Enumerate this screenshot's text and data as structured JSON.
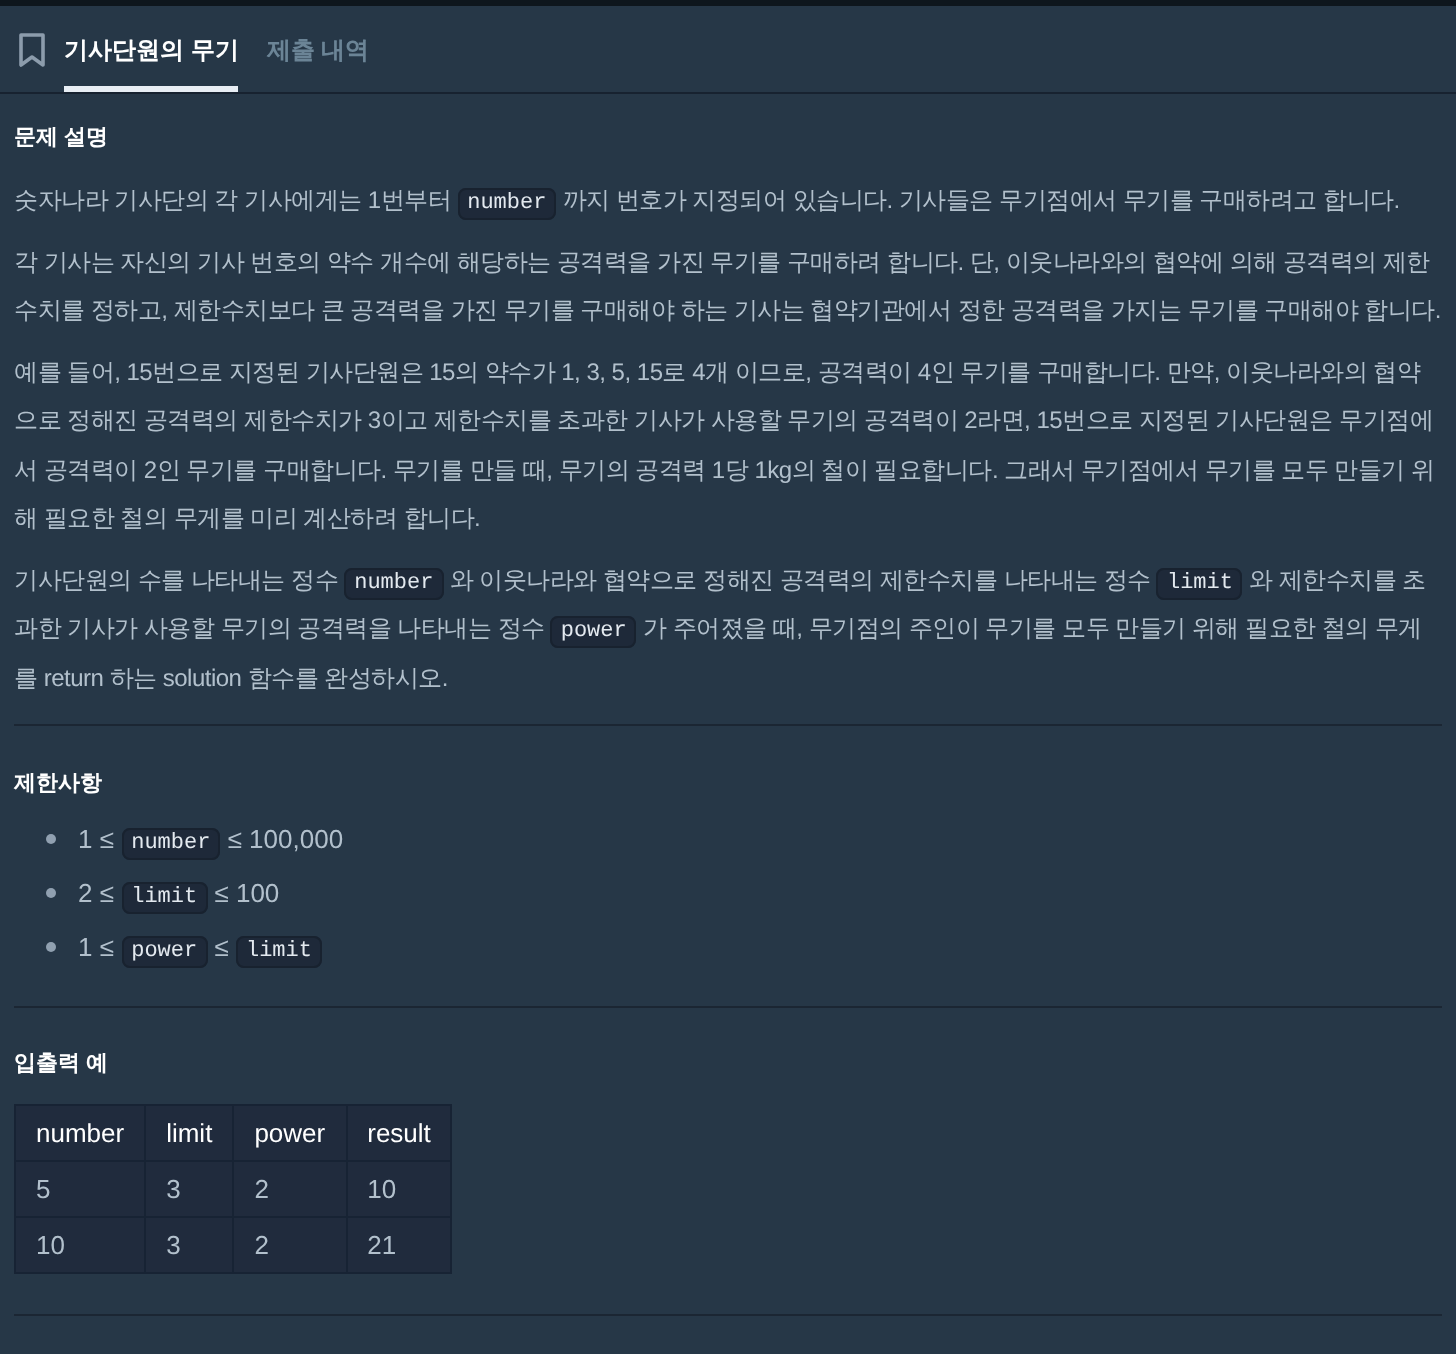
{
  "tabs": [
    {
      "label": "기사단원의 무기",
      "selected": true
    },
    {
      "label": "제출 내역",
      "selected": false
    }
  ],
  "description": {
    "heading": "문제 설명",
    "paragraphs": [
      [
        {
          "kind": "text",
          "text": "숫자나라 기사단의 각 기사에게는 1번부터 "
        },
        {
          "kind": "code",
          "text": "number"
        },
        {
          "kind": "text",
          "text": " 까지 번호가 지정되어 있습니다. 기사들은 무기점에서 무기를 구매하려고 합니다."
        }
      ],
      [
        {
          "kind": "text",
          "text": "각 기사는 자신의 기사 번호의 약수 개수에 해당하는 공격력을 가진 무기를 구매하려 합니다. 단, 이웃나라와의 협약에 의해 공격력의 제한수치를 정하고, 제한수치보다 큰 공격력을 가진 무기를 구매해야 하는 기사는 협약기관에서 정한 공격력을 가지는 무기를 구매해야 합니다."
        }
      ],
      [
        {
          "kind": "text",
          "text": "예를 들어, 15번으로 지정된 기사단원은 15의 약수가 1, 3, 5, 15로 4개 이므로, 공격력이 4인 무기를 구매합니다. 만약, 이웃나라와의 협약으로 정해진 공격력의 제한수치가 3이고 제한수치를 초과한 기사가 사용할 무기의 공격력이 2라면, 15번으로 지정된 기사단원은 무기점에서 공격력이 2인 무기를 구매합니다. 무기를 만들 때, 무기의 공격력 1당 1kg의 철이 필요합니다. 그래서 무기점에서 무기를 모두 만들기 위해 필요한 철의 무게를 미리 계산하려 합니다."
        }
      ],
      [
        {
          "kind": "text",
          "text": "기사단원의 수를 나타내는 정수 "
        },
        {
          "kind": "code",
          "text": "number"
        },
        {
          "kind": "text",
          "text": " 와 이웃나라와 협약으로 정해진 공격력의 제한수치를 나타내는 정수 "
        },
        {
          "kind": "code",
          "text": "limit"
        },
        {
          "kind": "text",
          "text": " 와 제한수치를 초과한 기사가 사용할 무기의 공격력을 나타내는 정수 "
        },
        {
          "kind": "code",
          "text": "power"
        },
        {
          "kind": "text",
          "text": " 가 주어졌을 때, 무기점의 주인이 무기를 모두 만들기 위해 필요한 철의 무게를 return 하는 solution 함수를 완성하시오."
        }
      ]
    ]
  },
  "constraints": {
    "heading": "제한사항",
    "items": [
      [
        {
          "kind": "text",
          "text": "1 ≤ "
        },
        {
          "kind": "code",
          "text": "number"
        },
        {
          "kind": "text",
          "text": " ≤ 100,000"
        }
      ],
      [
        {
          "kind": "text",
          "text": "2 ≤ "
        },
        {
          "kind": "code",
          "text": "limit"
        },
        {
          "kind": "text",
          "text": " ≤ 100"
        }
      ],
      [
        {
          "kind": "text",
          "text": "1 ≤ "
        },
        {
          "kind": "code",
          "text": "power"
        },
        {
          "kind": "text",
          "text": " ≤ "
        },
        {
          "kind": "code",
          "text": "limit"
        }
      ]
    ]
  },
  "examples": {
    "heading": "입출력 예",
    "table": {
      "columns": [
        "number",
        "limit",
        "power",
        "result"
      ],
      "rows": [
        [
          "5",
          "3",
          "2",
          "10"
        ],
        [
          "10",
          "3",
          "2",
          "21"
        ]
      ]
    }
  }
}
